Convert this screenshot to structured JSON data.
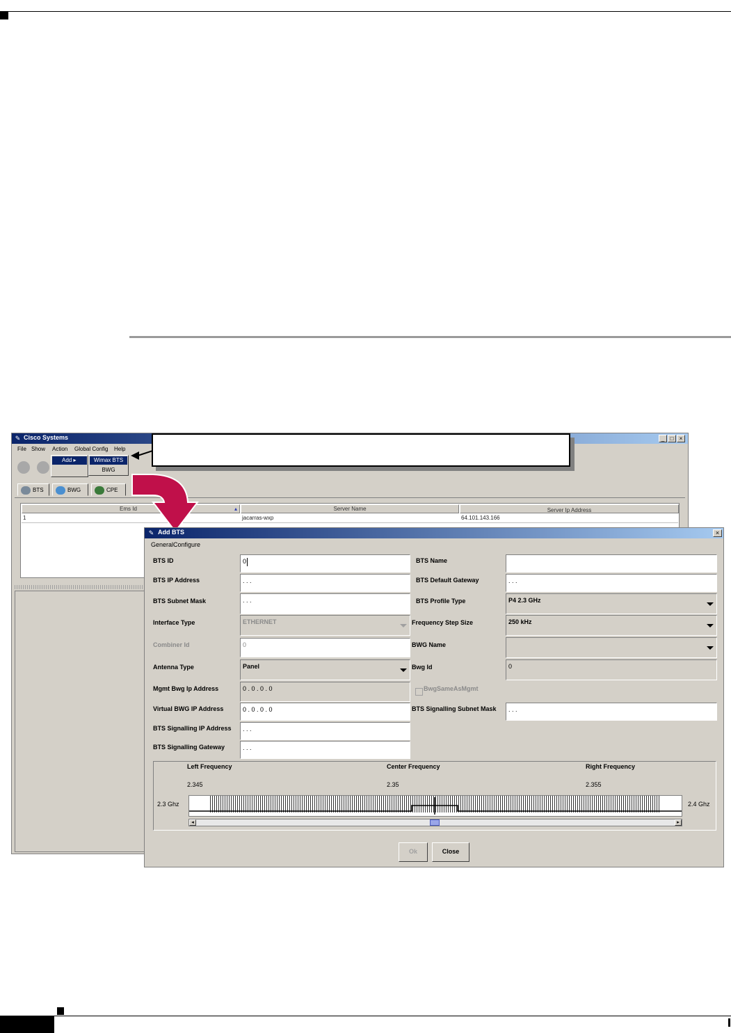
{
  "main_window": {
    "title": "Cisco Systems",
    "controls": {
      "minimize": "_",
      "maximize": "□",
      "close": "×"
    },
    "menu": [
      "File",
      "Show",
      "Action",
      "Global Config",
      "Help"
    ],
    "action_menu": {
      "add": "Add"
    },
    "add_submenu": [
      "Wimax BTS",
      "BWG"
    ],
    "tabs": [
      "BTS",
      "BWG",
      "CPE"
    ],
    "table": {
      "columns": [
        "Ems Id",
        "Server Name",
        "Server Ip Address"
      ],
      "rows": [
        [
          "1",
          "jacarras-wxp",
          "64.101.143.166"
        ]
      ]
    }
  },
  "dialog": {
    "title": "Add BTS",
    "close": "×",
    "section": "GeneralConfigure",
    "left_fields": {
      "bts_id": {
        "label": "BTS ID",
        "value": "0"
      },
      "bts_ip": {
        "label": "BTS IP Address",
        "value": " .  .  . "
      },
      "bts_subnet": {
        "label": "BTS Subnet Mask",
        "value": " .  .  . "
      },
      "interface_type": {
        "label": "Interface Type",
        "value": "ETHERNET"
      },
      "combiner_id": {
        "label": "Combiner Id",
        "value": "0"
      },
      "antenna_type": {
        "label": "Antenna Type",
        "value": "Panel"
      },
      "mgmt_bwg_ip": {
        "label": "Mgmt Bwg Ip Address",
        "value": "0 . 0 . 0 . 0"
      },
      "virtual_bwg_ip": {
        "label": "Virtual BWG IP Address",
        "value": "0 . 0 . 0 . 0"
      },
      "signalling_ip": {
        "label": "BTS Signalling IP Address",
        "value": " .  .  . "
      },
      "signalling_gw": {
        "label": "BTS Signalling Gateway",
        "value": " .  .  . "
      }
    },
    "right_fields": {
      "bts_name": {
        "label": "BTS Name",
        "value": ""
      },
      "bts_gateway": {
        "label": "BTS Default Gateway",
        "value": " .  .  . "
      },
      "profile_type": {
        "label": "BTS Profile Type",
        "value": "P4 2.3 GHz"
      },
      "freq_step": {
        "label": "Frequency Step Size",
        "value": "250 kHz"
      },
      "bwg_name": {
        "label": "BWG Name",
        "value": ""
      },
      "bwg_id": {
        "label": "Bwg Id",
        "value": "0"
      },
      "bwg_same": {
        "label": "BwgSameAsMgmt",
        "checked": false
      },
      "signalling_subnet": {
        "label": "BTS Signalling Subnet Mask",
        "value": " .  .  . "
      }
    },
    "frequency": {
      "left_label": "Left Frequency",
      "center_label": "Center Frequency",
      "right_label": "Right Frequency",
      "left_value": "2.345",
      "center_value": "2.35",
      "right_value": "2.355",
      "min_label": "2.3 Ghz",
      "max_label": "2.4 Ghz",
      "scroll_position": 0.5
    },
    "buttons": {
      "ok": "Ok",
      "close": "Close"
    }
  },
  "colors": {
    "titlebar": "#0a246a",
    "window_bg": "#d4d0c8",
    "callout_arrow": "#c0104a"
  }
}
